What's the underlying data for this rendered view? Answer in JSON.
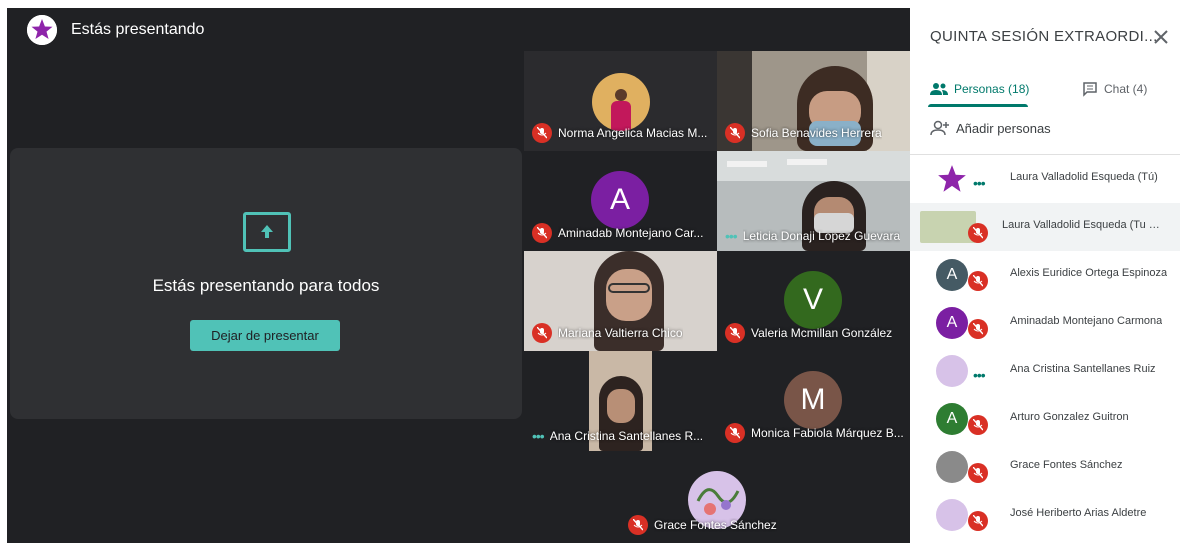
{
  "header": {
    "presenting_label": "Estás presentando"
  },
  "presentation": {
    "message": "Estás presentando para todos",
    "stop_button": "Dejar de presentar"
  },
  "tiles": [
    {
      "name": "Norma Angelica Macias M...",
      "muted": true
    },
    {
      "name": "Sofia Benavides Herrera",
      "muted": true
    },
    {
      "name": "Aminadab Montejano Car...",
      "muted": true,
      "initial": "A",
      "color": "#7b1fa2"
    },
    {
      "name": "Leticia Donaji Lopez Guevara",
      "speaking": true
    },
    {
      "name": "Mariana Valtierra Chico",
      "muted": true
    },
    {
      "name": "Valeria Mcmillan González",
      "muted": true,
      "initial": "V",
      "color": "#33691e"
    },
    {
      "name": "Ana Cristina Santellanes R...",
      "speaking": true
    },
    {
      "name": "Monica Fabiola Márquez B...",
      "muted": true,
      "initial": "M",
      "color": "#795548"
    },
    {
      "name": "Grace Fontes Sánchez",
      "muted": true
    }
  ],
  "sidebar": {
    "title": "QUINTA SESIÓN EXTRAORDI...",
    "tabs": [
      {
        "label": "Personas (18)"
      },
      {
        "label": "Chat (4)"
      }
    ],
    "add_people": "Añadir personas",
    "people": [
      {
        "name": "Laura Valladolid Esqueda (Tú)",
        "status": "speaking"
      },
      {
        "name": "Laura Valladolid Esqueda (Tu p...",
        "status": "muted"
      },
      {
        "name": "Alexis Euridice Ortega Espinoza",
        "status": "muted",
        "initial": "A",
        "color": "#455a64"
      },
      {
        "name": "Aminadab Montejano Carmona",
        "status": "muted",
        "initial": "A",
        "color": "#7b1fa2"
      },
      {
        "name": "Ana Cristina Santellanes Ruiz",
        "status": "speaking"
      },
      {
        "name": "Arturo Gonzalez Guitron",
        "status": "muted",
        "initial": "A",
        "color": "#2e7d32"
      },
      {
        "name": "Grace Fontes Sánchez",
        "status": "muted"
      },
      {
        "name": "José Heriberto Arias Aldetre",
        "status": "muted"
      }
    ]
  },
  "colors": {
    "accent": "#00796b",
    "present_accent": "#50c2b7",
    "mute_red": "#d93025",
    "stage_bg": "#202124"
  }
}
